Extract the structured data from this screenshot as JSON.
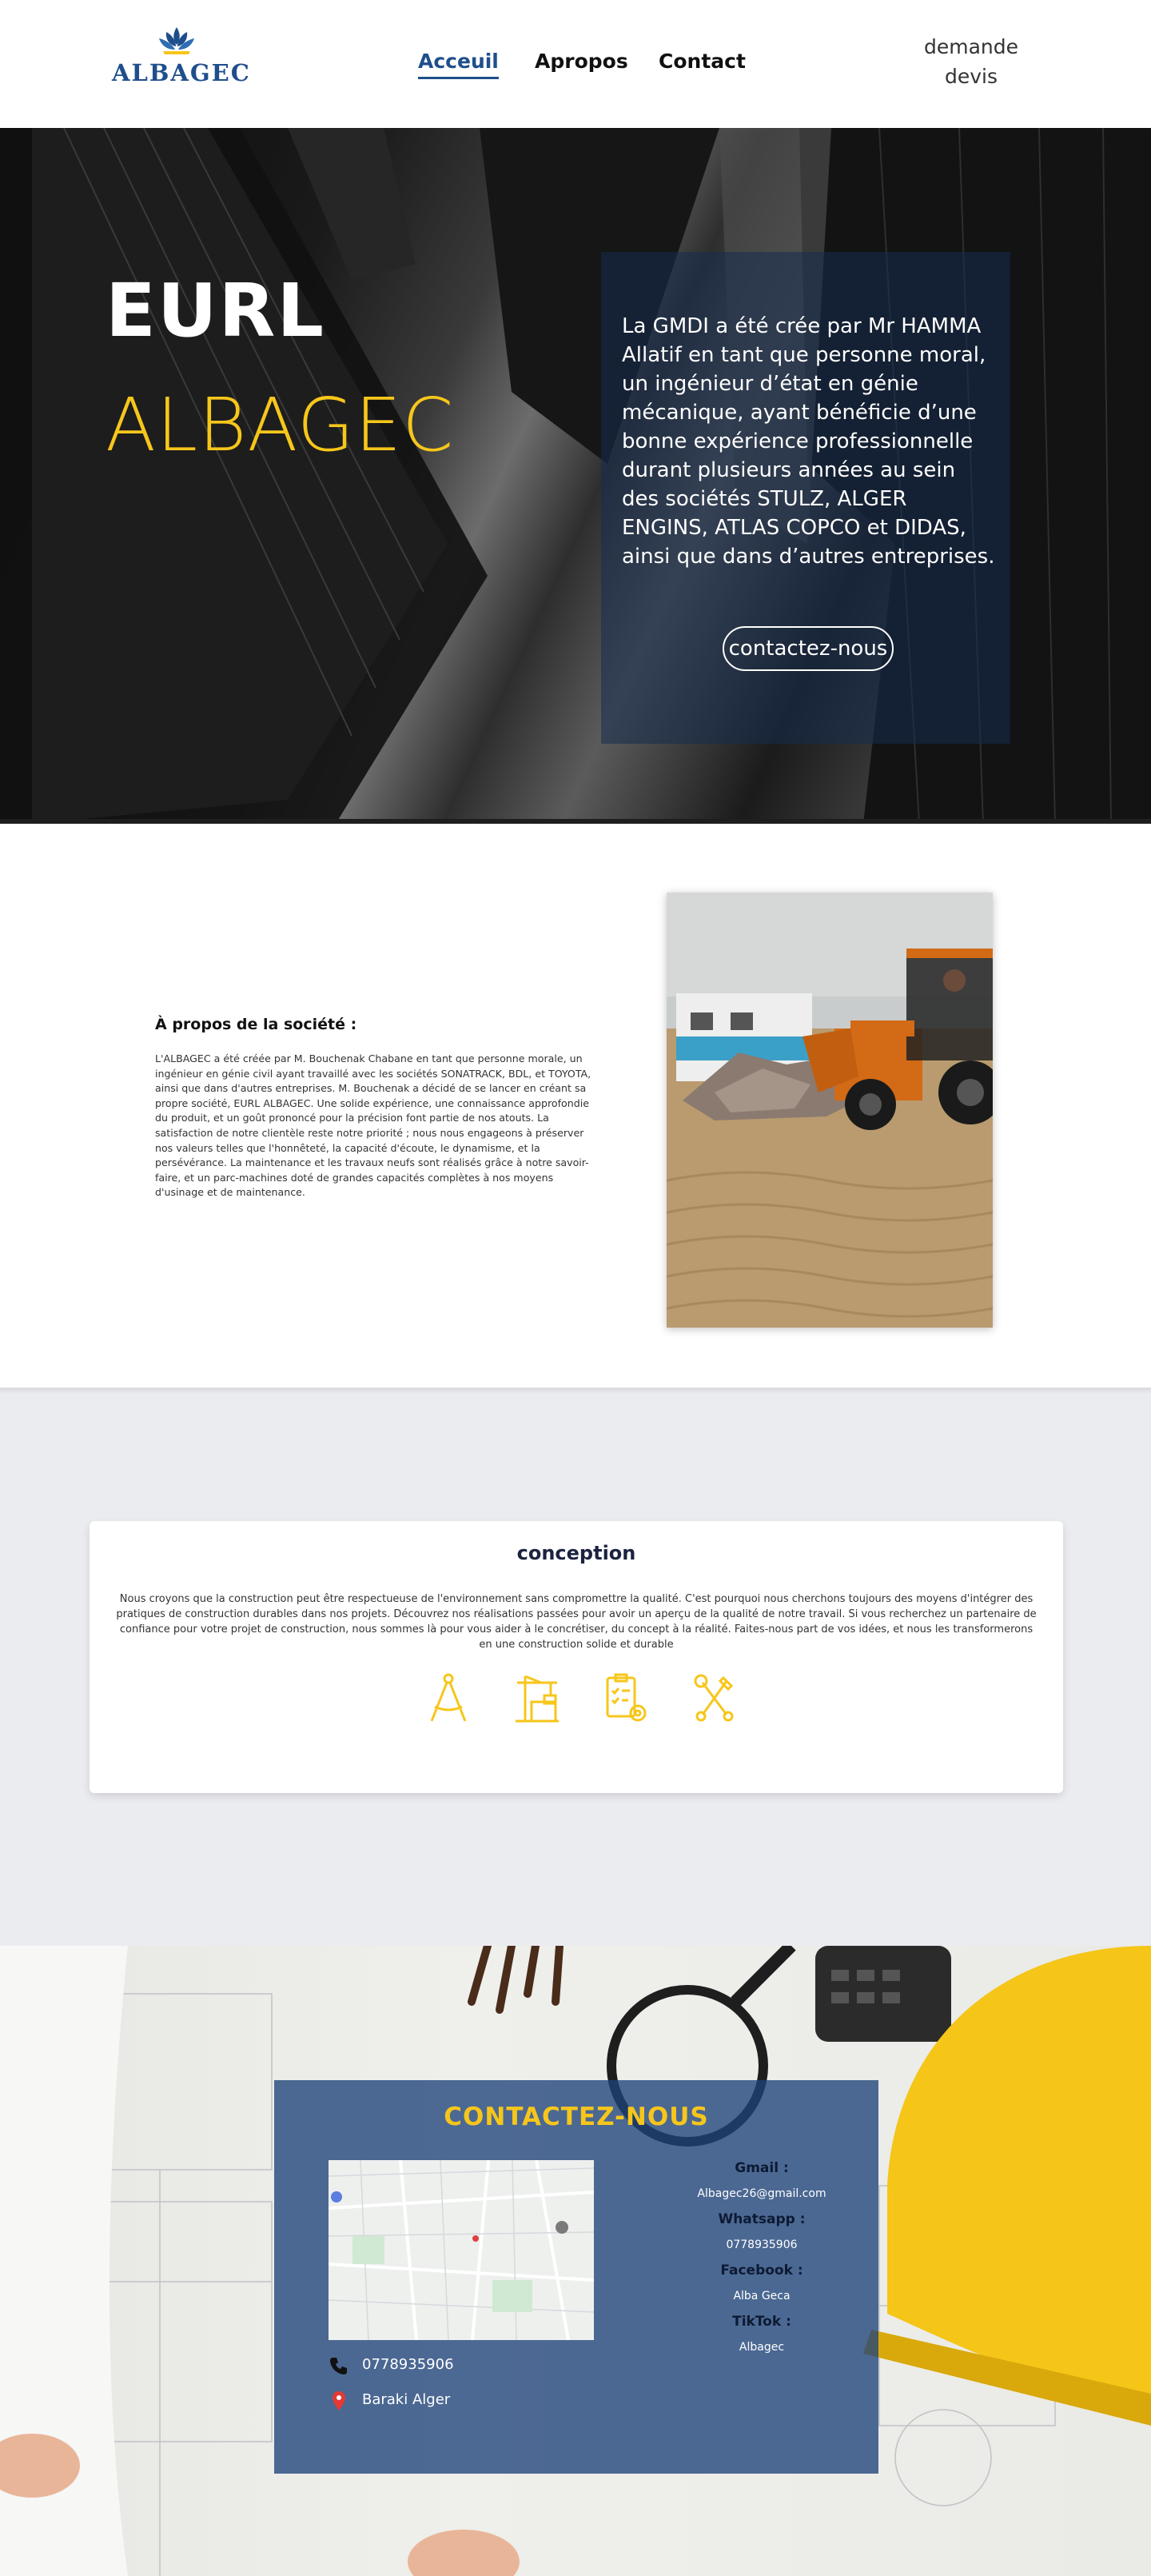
{
  "header": {
    "logo_text": "ALBAGEC",
    "nav": [
      {
        "label": "Acceuil",
        "active": true
      },
      {
        "label": "Apropos",
        "active": false
      },
      {
        "label": "Contact",
        "active": false
      }
    ],
    "devis_label": "demande devis"
  },
  "hero": {
    "title_line1": "EURL",
    "title_line2": "ALBAGEC",
    "description": "La GMDI a été crée par Mr HAMMA Allatif en tant que personne moral, un ingénieur d’état en génie mécanique, ayant bénéficie d’une bonne expérience professionnelle durant plusieurs années au sein des sociétés STULZ, ALGER ENGINS, ATLAS COPCO et DIDAS, ainsi que dans d’autres entreprises.",
    "button_label": "contactez-nous",
    "accent_color": "#f6c61b"
  },
  "about": {
    "title": "À propos de la société :",
    "text": "L'ALBAGEC a été créée par M. Bouchenak Chabane en tant que personne morale, un ingénieur en génie civil ayant travaillé avec les sociétés SONATRACK, BDL, et TOYOTA, ainsi que dans d'autres entreprises. M. Bouchenak a décidé de se lancer en créant sa propre société, EURL ALBAGEC. Une solide expérience, une connaissance approfondie du produit, et un goût prononcé pour la précision font partie de nos atouts. La satisfaction de notre clientèle reste notre priorité ; nous nous engageons à préserver nos valeurs telles que l'honnêteté, la capacité d'écoute, le dynamisme, et la persévérance. La maintenance et les travaux neufs sont réalisés grâce à notre savoir-faire, et un parc-machines doté de grandes capacités complètes à nos moyens d'usinage et de maintenance."
  },
  "conception": {
    "title": "conception",
    "text": "Nous croyons que la construction peut être respectueuse de l'environnement sans compromettre la qualité. C'est pourquoi nous cherchons toujours des moyens d'intégrer des pratiques de construction durables dans nos projets. Découvrez nos réalisations passées pour avoir un aperçu de la qualité de notre travail. Si vous recherchez un partenaire de confiance pour votre projet de construction, nous sommes là pour vous aider à le concrétiser, du concept à la réalité. Faites-nous part de vos idées, et nous les transformerons en une construction solide et durable",
    "icons": [
      "compass-icon",
      "crane-icon",
      "checklist-gear-icon",
      "tools-icon"
    ],
    "icon_color": "#f6c61b"
  },
  "contact": {
    "title": "CONTACTEZ-NOUS",
    "phone": "0778935906",
    "address": "Baraki Alger",
    "info": [
      {
        "label": "Gmail :",
        "value": "Albagec26@gmail.com"
      },
      {
        "label": "Whatsapp :",
        "value": "0778935906"
      },
      {
        "label": "Facebook :",
        "value": "Alba Geca"
      },
      {
        "label": "TikTok :",
        "value": "Albagec"
      }
    ]
  }
}
